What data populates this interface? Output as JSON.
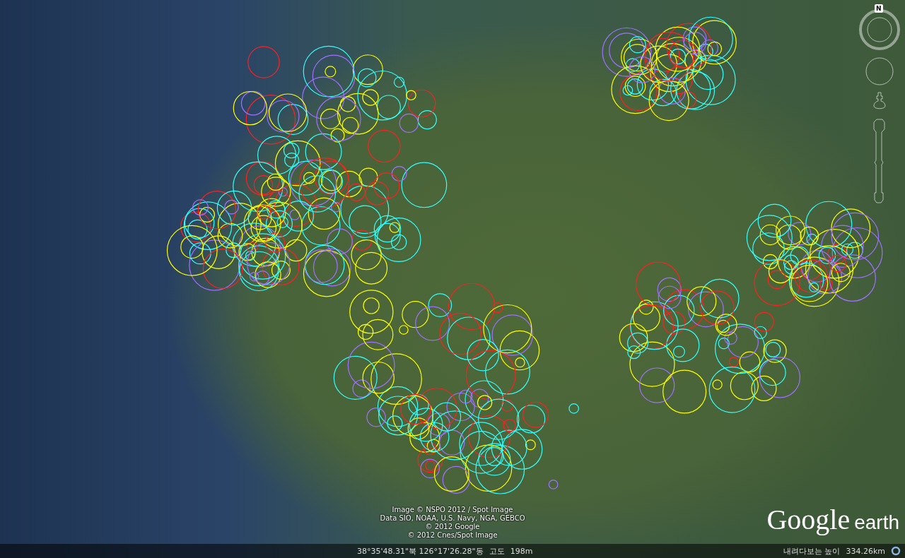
{
  "navigation": {
    "compass_label": "N"
  },
  "attribution": [
    "Image © NSPO 2012 / Spot Image",
    "Data SIO, NOAA, U.S. Navy, NGA, GEBCO",
    "© 2012 Google",
    "© 2012 Cnes/Spot Image"
  ],
  "logo": {
    "brand": "Google",
    "product": "earth"
  },
  "status_bar": {
    "coordinates": "38°35'48.31\"북 126°17'26.28\"동",
    "elevation_label": "고도",
    "elevation": "198m",
    "eye_alt_label": "내려다보는 높이",
    "eye_alt": "334.26km"
  }
}
